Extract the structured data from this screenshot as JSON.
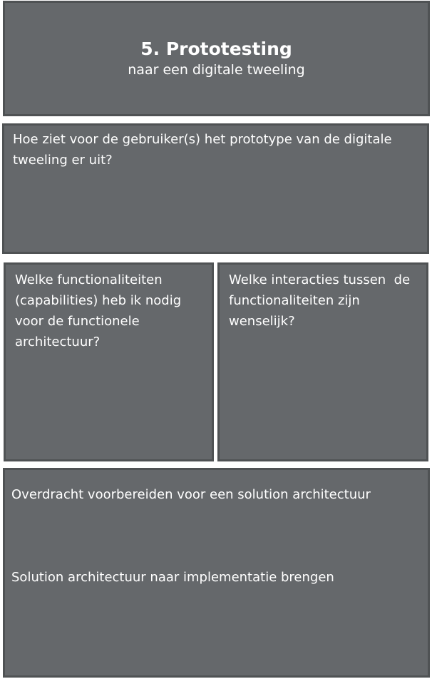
{
  "header": {
    "title": "5. Prototesting",
    "subtitle": "naar een digitale tweeling"
  },
  "question_panel": {
    "text": "Hoe ziet voor de gebruiker(s) het prototype van de digitale tweeling er uit?"
  },
  "capabilities_panel": {
    "text": "Welke functionaliteiten (capabilities) heb ik nodig voor de functionele architectuur?"
  },
  "interactions_panel": {
    "text": "Welke interacties tussen  de  functionaliteiten zijn wenselijk?"
  },
  "handover_panel": {
    "line1": "Overdracht voorbereiden voor een solution architectuur",
    "line2": "Solution architectuur naar implementatie brengen"
  },
  "colors": {
    "panel_fill": "#65686b",
    "panel_border": "#4f5254",
    "text": "#ffffff"
  }
}
